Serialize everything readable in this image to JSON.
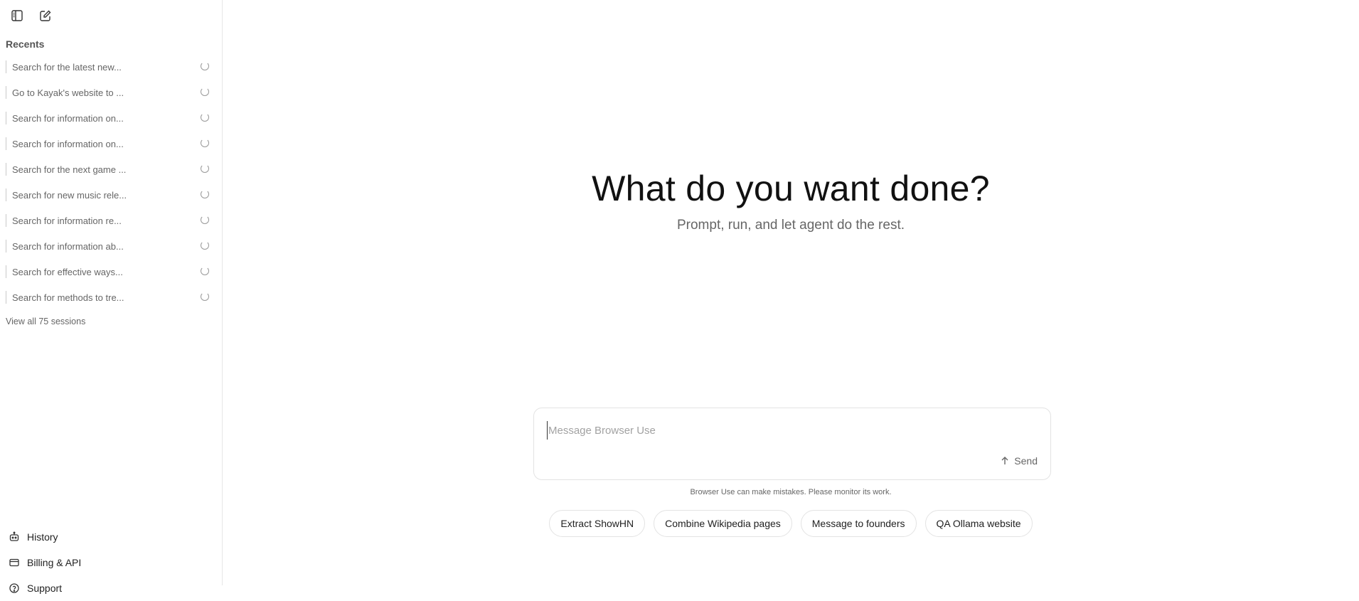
{
  "sidebar": {
    "toggle_icon": "sidebar-toggle-icon",
    "new_chat_icon": "edit-icon",
    "recents_label": "Recents",
    "recents": [
      {
        "label": "Search for the latest new..."
      },
      {
        "label": "Go to Kayak's website to ..."
      },
      {
        "label": "Search for information on..."
      },
      {
        "label": "Search for information on..."
      },
      {
        "label": "Search for the next game ..."
      },
      {
        "label": "Search for new music rele..."
      },
      {
        "label": "Search for information re..."
      },
      {
        "label": "Search for information ab..."
      },
      {
        "label": "Search for effective ways..."
      },
      {
        "label": "Search for methods to tre..."
      }
    ],
    "view_all": "View all 75 sessions",
    "bottom": {
      "history": "History",
      "billing": "Billing & API",
      "support": "Support"
    }
  },
  "main": {
    "title": "What do you want done?",
    "subtitle": "Prompt, run, and let agent do the rest.",
    "input_placeholder": "Message Browser Use",
    "input_value": "",
    "send_label": "Send",
    "disclaimer": "Browser Use can make mistakes. Please monitor its work.",
    "suggestions": [
      "Extract ShowHN",
      "Combine Wikipedia pages",
      "Message to founders",
      "QA Ollama website"
    ]
  },
  "colors": {
    "background": "#ffffff",
    "border": "#e3e3e3",
    "muted_text": "#666666"
  }
}
